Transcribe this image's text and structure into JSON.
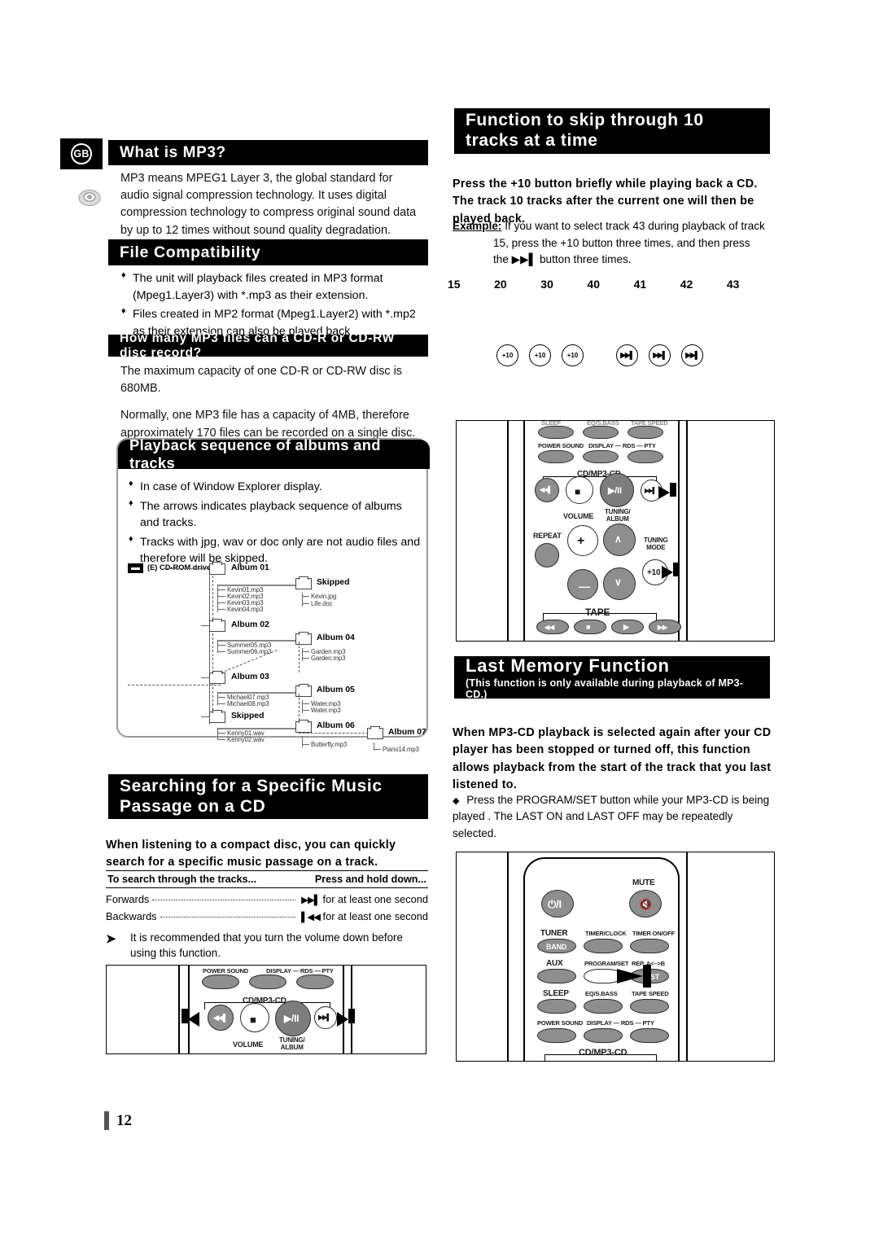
{
  "page": {
    "number": "12",
    "locale_badge": "GB"
  },
  "left": {
    "what_is_mp3": {
      "title": "What is MP3?",
      "body": "MP3 means MPEG1 Layer 3, the global standard for audio signal compression technology. It uses digital compression technology to compress original sound data by up to 12 times without sound quality degradation."
    },
    "file_compatibility": {
      "title": "File Compatibility",
      "bullets": [
        "The unit will playback files created in MP3 format (Mpeg1.Layer3) with *.mp3 as their extension.",
        "Files created in MP2 format (Mpeg1.Layer2) with *.mp2 as their extension can also be played back."
      ]
    },
    "how_many": {
      "title": "How many MP3 files can a CD-R or CD-RW disc record?",
      "para1": "The maximum capacity of one CD-R or CD-RW disc is 680MB.",
      "para2": "Normally, one MP3 file has a capacity of 4MB, therefore approximately 170 files can be recorded on a single disc."
    },
    "playback_sequence": {
      "title": "Playback sequence of albums and tracks",
      "bullets": [
        "In case of Window Explorer display.",
        "The arrows indicates playback sequence of albums and tracks.",
        "Tracks with jpg, wav or doc only are not audio files and therefore will be skipped."
      ],
      "tree": {
        "drive": "(E) CD-ROM drive",
        "folders": [
          {
            "name": "Album 01",
            "files": [
              "Kevin01.mp3",
              "Kevin02.mp3",
              "Kevin03.mp3",
              "Kevin04.mp3"
            ]
          },
          {
            "name": "Skipped",
            "files": [
              "Kevin.jpg",
              "Life.doc"
            ]
          },
          {
            "name": "Album 02",
            "files": [
              "Summer05.mp3",
              "Summer06.mp3"
            ]
          },
          {
            "name": "Album 04",
            "files": [
              "Garden.mp3",
              "Garden.mp3"
            ]
          },
          {
            "name": "Album 03",
            "files": [
              "Michael07.mp3",
              "Michael08.mp3"
            ]
          },
          {
            "name": "Album 05",
            "files": [
              "Water.mp3",
              "Water.mp3"
            ]
          },
          {
            "name": "Skipped",
            "files": [
              "Kenny01.wav",
              "Kenny02.wav"
            ]
          },
          {
            "name": "Album 06",
            "files": [
              "Butterfly.mp3"
            ]
          },
          {
            "name": "Album 07",
            "files": [
              "Piano14.mp3"
            ]
          }
        ]
      }
    },
    "searching": {
      "title_line1": "Searching for a Specific Music",
      "title_line2": "Passage on a CD",
      "intro": "When listening to a compact disc, you can quickly search for a specific music passage on a track.",
      "table": {
        "col1_header": "To search through the tracks...",
        "col2_header": "Press and hold down...",
        "rows": [
          {
            "label": "Forwards",
            "icon": "▶▶▌",
            "after": "for at least one second"
          },
          {
            "label": "Backwards",
            "icon": "▌◀◀",
            "after": "for at least one second"
          }
        ]
      },
      "note": "It is recommended that you turn the volume down before using this function."
    }
  },
  "right": {
    "skip10": {
      "title_line1": "Function to skip through 10",
      "title_line2": "tracks at a time",
      "instruction": "Press the +10 button briefly while playing back a CD. The track 10 tracks after the current one will then be played back.",
      "example_label": "Example:",
      "example_line1": "If you want to select track 43 during playback of track",
      "example_line2": "15, press the +10 button three times, and then press",
      "example_line3": "the ▶▶▌ button three times.",
      "track_numbers": [
        "15",
        "20",
        "30",
        "40",
        "41",
        "42",
        "43"
      ],
      "buttons": [
        "+10",
        "+10",
        "+10",
        "skip",
        "skip",
        "skip"
      ]
    },
    "last_memory": {
      "title": "Last Memory Function",
      "subtitle": "(This function is only available during playback of MP3-CD.)",
      "body": "When MP3-CD playback is selected again after your CD player has been stopped or turned off, this function allows playback from the start of the track that you last listened to.",
      "note": "Press the PROGRAM/SET button while your MP3-CD is being played . The LAST ON and LAST OFF may be repeatedly selected."
    }
  },
  "remote_top_right": {
    "labels_cut": [
      "SLEEP",
      "EQ/S.BASS",
      "TAPE SPEED"
    ],
    "row_labels": [
      "POWER SOUND",
      "DISPLAY — RDS — PTY"
    ],
    "group_cd": "CD/MP3-CD",
    "volume": "VOLUME",
    "tuning_album": "TUNING/\nALBUM",
    "repeat": "REPEAT",
    "tuning_mode": "TUNING\nMODE",
    "plus10": "+10",
    "group_tape": "TAPE"
  },
  "remote_bottom_right": {
    "mute": "MUTE",
    "power_icon": "⏻/I",
    "grid": [
      [
        "TUNER",
        "TIMER/CLOCK",
        "TIMER ON/OFF"
      ],
      [
        "AUX",
        "PROGRAM/SET",
        "REP.,A<–>B"
      ],
      [
        "SLEEP",
        "EQ/S.BASS",
        "TAPE SPEED"
      ],
      [
        "POWER SOUND",
        "DISPLAY — RDS — PTY",
        ""
      ]
    ],
    "band": "BAND",
    "st": "ST",
    "group_cd": "CD/MP3-CD"
  },
  "remote_bottom_left": {
    "row_labels": [
      "POWER SOUND",
      "DISPLAY — RDS — PTY"
    ],
    "group_cd": "CD/MP3-CD",
    "volume": "VOLUME",
    "tuning_album": "TUNING/\nALBUM"
  }
}
